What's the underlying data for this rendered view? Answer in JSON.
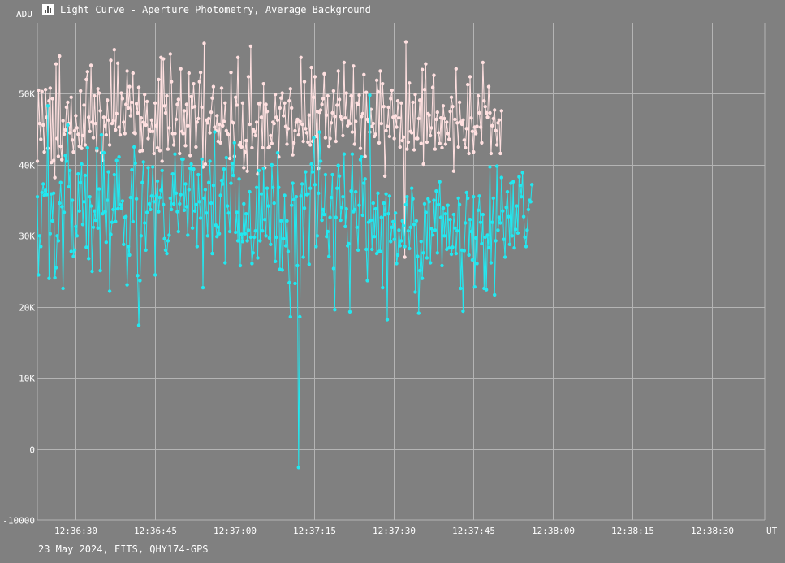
{
  "window": {
    "title": "Light Curve - Aperture Photometry, Average Background",
    "icon": "chart-icon"
  },
  "footer": "23 May 2024, FITS, QHY174-GPS",
  "colors": {
    "background": "#808080",
    "grid": "#b4b4b4",
    "series_upper": "#ffe0e0",
    "series_lower": "#22e8f0",
    "text": "#ffffff"
  },
  "chart_data": {
    "type": "line",
    "title": "Light Curve - Aperture Photometry, Average Background",
    "xlabel": "UT",
    "ylabel": "ADU",
    "grid": true,
    "x_range": [
      "12:36:22.8",
      "12:38:40"
    ],
    "ylim": [
      -10000,
      60000
    ],
    "y_ticks": [
      {
        "value": 50000,
        "label": "50K"
      },
      {
        "value": 40000,
        "label": "40K"
      },
      {
        "value": 30000,
        "label": "30K"
      },
      {
        "value": 20000,
        "label": "20K"
      },
      {
        "value": 10000,
        "label": "10K"
      },
      {
        "value": 0,
        "label": "0"
      },
      {
        "value": -10000,
        "label": "-10000"
      }
    ],
    "x_ticks": [
      "12:36:30",
      "12:36:45",
      "12:37:00",
      "12:37:15",
      "12:37:30",
      "12:37:45",
      "12:38:00",
      "12:38:15",
      "12:38:30"
    ],
    "series": [
      {
        "color": "#ffe0e0",
        "x_start": "12:36:22.8",
        "x_step_seconds": 0.22,
        "values": [
          40500,
          50500,
          45800,
          43600,
          50300,
          45600,
          41800,
          50600,
          46700,
          42300,
          49000,
          50800,
          40300,
          49300,
          40600,
          38200,
          54200,
          43700,
          41200,
          55300,
          42600,
          40700,
          46200,
          44300,
          44900,
          48100,
          48800,
          45800,
          44500,
          49500,
          43500,
          41800,
          44800,
          46900,
          45200,
          44300,
          42600,
          50400,
          42300,
          44100,
          48400,
          42800,
          52000,
          53100,
          46700,
          44700,
          54000,
          46000,
          43800,
          49700,
          45800,
          42000,
          50700,
          50100,
          47600,
          41700,
          40600,
          46700,
          45500,
          44200,
          49100,
          46300,
          42800,
          54700,
          45800,
          46200,
          56200,
          44900,
          47200,
          54300,
          45300,
          44200,
          50100,
          49300,
          46000,
          44400,
          48500,
          53200,
          48000,
          51000,
          46900,
          48800,
          52900,
          44500,
          44400,
          48600,
          47300,
          50900,
          41900,
          46600,
          42000,
          46000,
          49900,
          45600,
          48900,
          43700,
          44900,
          44700,
          46300,
          44700,
          41600,
          48700,
          45500,
          42400,
          52000,
          42000,
          55100,
          40500,
          54900,
          48300,
          47300,
          49700,
          42200,
          45200,
          55600,
          51700,
          44400,
          42800,
          44400,
          46400,
          48500,
          49200,
          41600,
          53500,
          44700,
          44400,
          47600,
          42700,
          48500,
          45500,
          52900,
          41300,
          49600,
          48100,
          51400,
          48200,
          42500,
          46000,
          46500,
          51700,
          53000,
          48100,
          39700,
          57100,
          40100,
          46300,
          45900,
          46500,
          44500,
          47400,
          49400,
          51000,
          45300,
          44800,
          46900,
          43300,
          45700,
          43100,
          50800,
          45500,
          46100,
          48700,
          44800,
          44400,
          44200,
          40900,
          53000,
          46000,
          45900,
          41200,
          49500,
          48400,
          55100,
          42800,
          43100,
          42500,
          48700,
          39600,
          41800,
          43400,
          39100,
          52400,
          45700,
          56700,
          42400,
          45000,
          44700,
          44100,
          46000,
          38700,
          48600,
          48700,
          46700,
          42400,
          51400,
          39600,
          48500,
          47500,
          42400,
          42500,
          44100,
          43000,
          46000,
          45800,
          49900,
          46700,
          46300,
          41100,
          48000,
          49400,
          50100,
          46900,
          48700,
          45400,
          42900,
          45100,
          49000,
          50700,
          48000,
          41400,
          43100,
          44800,
          46000,
          46400,
          44200,
          46100,
          55100,
          45700,
          43300,
          51700,
          45100,
          44500,
          43200,
          47000,
          42800,
          53700,
          43300,
          49500,
          52400,
          44000,
          47500,
          39500,
          47400,
          47700,
          48500,
          49300,
          52800,
          43800,
          47000,
          49700,
          42600,
          43700,
          45900,
          47300,
          50400,
          46800,
          43300,
          48400,
          53200,
          49200,
          46800,
          46400,
          44100,
          54400,
          46600,
          50100,
          45500,
          46100,
          45800,
          49700,
          44600,
          53900,
          42900,
          46100,
          48700,
          48500,
          49800,
          42300,
          46800,
          47200,
          52700,
          41200,
          50200,
          46400,
          46100,
          44600,
          47800,
          45400,
          45800,
          44000,
          44300,
          51900,
          50300,
          43100,
          53200,
          45800,
          51400,
          48200,
          38400,
          44800,
          45400,
          48100,
          44000,
          49300,
          50500,
          46700,
          43700,
          46900,
          45300,
          49000,
          46600,
          42500,
          48700,
          43400,
          43900,
          27000,
          57300,
          42200,
          43200,
          51500,
          44700,
          44500,
          48800,
          42100,
          49900,
          43700,
          43700,
          46500,
          49100,
          43000,
          53400,
          40100,
          50600,
          54200,
          43200,
          47200,
          47000,
          44100,
          45200,
          50900,
          52600,
          42200,
          46400,
          47400,
          44500,
          43000,
          46600,
          42400,
          48300,
          46500,
          42900,
          46000,
          44400,
          43600,
          47500,
          49500,
          48200,
          39100,
          46400,
          53500,
          45900,
          42500,
          48800,
          46000,
          45700,
          46300,
          43500,
          42400,
          45100,
          51300,
          41600,
          52400,
          46600,
          44700,
          41800,
          45300,
          44400,
          45400,
          49700,
          47300,
          45300,
          43100,
          54400,
          49000,
          48200,
          47300,
          46700,
          51000,
          47300,
          41600,
          45500,
          46500,
          47700,
          44800,
          42800,
          45900,
          46300,
          41600,
          47600
        ]
      },
      {
        "color": "#22e8f0",
        "x_start": "12:36:22.8",
        "x_step_seconds": 0.22,
        "values": [
          35500,
          24500,
          30000,
          28500,
          36100,
          37300,
          35700,
          36400,
          35800,
          48300,
          24000,
          30300,
          35900,
          32100,
          36000,
          24100,
          25500,
          30000,
          29300,
          34600,
          37500,
          34100,
          22600,
          33300,
          41300,
          40500,
          45600,
          36900,
          39200,
          27800,
          35000,
          27100,
          28000,
          31300,
          30000,
          38700,
          33500,
          37500,
          40100,
          31600,
          34800,
          38500,
          28400,
          42400,
          26800,
          35500,
          34200,
          25000,
          31200,
          33500,
          32200,
          42300,
          31100,
          36600,
          25100,
          44200,
          33100,
          41700,
          33400,
          29100,
          35000,
          39000,
          22200,
          30200,
          31900,
          33700,
          38600,
          32000,
          40600,
          33800,
          41100,
          34400,
          33900,
          34900,
          28800,
          32600,
          32700,
          23100,
          28500,
          27300,
          35400,
          39300,
          32000,
          42500,
          40200,
          35200,
          24400,
          17400,
          23700,
          30000,
          37500,
          40400,
          31800,
          28000,
          33300,
          39600,
          34500,
          33700,
          35600,
          39700,
          34800,
          24500,
          35600,
          37700,
          33400,
          35400,
          36400,
          39200,
          34400,
          29600,
          28000,
          27500,
          29300,
          30100,
          35300,
          33700,
          38700,
          34500,
          41500,
          36000,
          33400,
          30600,
          34500,
          35800,
          40800,
          40800,
          33600,
          37300,
          34100,
          30100,
          36500,
          39500,
          40100,
          31100,
          39400,
          33500,
          34400,
          28500,
          38600,
          34800,
          32500,
          40800,
          22700,
          35300,
          36500,
          33200,
          30000,
          37500,
          40500,
          34600,
          27500,
          37100,
          44600,
          31500,
          29900,
          31200,
          30300,
          35700,
          37800,
          37300,
          39400,
          26200,
          41000,
          34200,
          33200,
          30600,
          37400,
          40200,
          38500,
          43100,
          30500,
          33300,
          29300,
          38000,
          25800,
          30200,
          29200,
          34500,
          30300,
          33100,
          29300,
          30800,
          36200,
          29800,
          26100,
          27600,
          29800,
          30700,
          36800,
          26900,
          39200,
          29300,
          35900,
          30700,
          39500,
          32300,
          30000,
          36700,
          34200,
          29700,
          28800,
          40000,
          36800,
          34600,
          26400,
          29800,
          41700,
          36800,
          25300,
          32100,
          25200,
          29600,
          35700,
          28600,
          32100,
          27800,
          23400,
          18600,
          34300,
          37400,
          35100,
          23300,
          35500,
          25800,
          -2600,
          18600,
          35600,
          37300,
          27000,
          33900,
          39000,
          35800,
          35900,
          26000,
          36700,
          40100,
          39000,
          43800,
          37200,
          28500,
          30000,
          36000,
          44600,
          40500,
          32200,
          33700,
          33000,
          38600,
          29900,
          30600,
          27100,
          32600,
          35400,
          38600,
          25400,
          19600,
          32600,
          36700,
          39900,
          38400,
          32200,
          34000,
          35500,
          41500,
          31300,
          33800,
          28600,
          28900,
          19300,
          36300,
          41500,
          33400,
          33700,
          36200,
          31200,
          28000,
          34300,
          40700,
          41100,
          32900,
          37400,
          38000,
          28100,
          23700,
          31900,
          49800,
          32200,
          28100,
          34600,
          29900,
          33800,
          27500,
          36000,
          27800,
          27800,
          32600,
          22700,
          34600,
          33000,
          35900,
          18200,
          33100,
          35600,
          29200,
          31200,
          32000,
          29500,
          33200,
          26100,
          27300,
          30800,
          28600,
          29300,
          32100,
          31400,
          28500,
          34400,
          35500,
          30700,
          28200,
          31200,
          36700,
          35200,
          31600,
          22100,
          32100,
          27100,
          19100,
          25100,
          29200,
          24000,
          27600,
          34500,
          33300,
          26900,
          35200,
          34800,
          26200,
          31000,
          30100,
          35000,
          30800,
          36300,
          27600,
          34400,
          37600,
          32600,
          25800,
          33900,
          30000,
          33100,
          28100,
          34300,
          28300,
          32300,
          27400,
          28400,
          33000,
          31100,
          27500,
          30700,
          35300,
          34400,
          22600,
          28000,
          19400,
          27900,
          31800,
          36100,
          35300,
          27300,
          32300,
          30600,
          26600,
          35500,
          22800,
          29700,
          26100,
          33600,
          35600,
          31900,
          28900,
          33000,
          22600,
          29800,
          22400,
          30100,
          28300,
          39700,
          26200,
          31900,
          35300,
          21700,
          29300,
          39800,
          30800,
          32600,
          31800,
          38200,
          33500,
          29500,
          27000,
          34000,
          36200,
          32700,
          28800,
          37400,
          30000,
          37600,
          28300,
          30900,
          34200,
          30400,
          38300,
          37100,
          35500,
          38900,
          32700,
          29800,
          28500,
          30800,
          33700,
          35000,
          34800,
          37200
        ]
      }
    ]
  }
}
